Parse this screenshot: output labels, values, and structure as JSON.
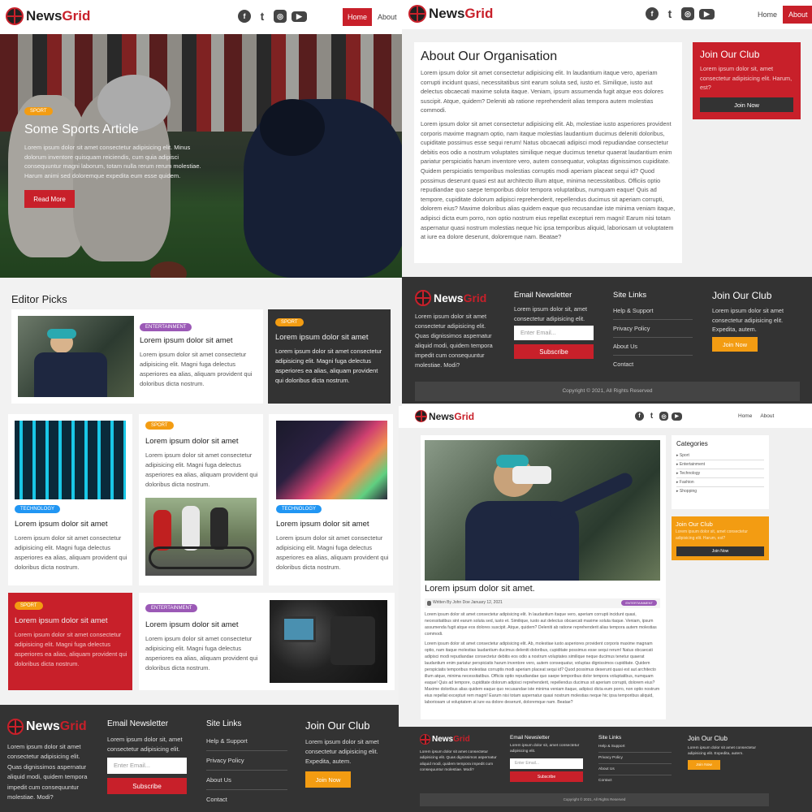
{
  "brand": {
    "news": "News",
    "grid": "Grid"
  },
  "nav": {
    "home": "Home",
    "about": "About"
  },
  "social": {
    "facebook": "f",
    "twitter": "t",
    "instagram": "◎",
    "youtube": "▶"
  },
  "hero": {
    "badge": "Sport",
    "title": "Some Sports Article",
    "text": "Lorem ipsum dolor sit amet consectetur adipisicing elit. Minus dolorum inventore quisquam reiciendis, cum quia adipisci consequuntur magni laborum, totam nulla rerum rerum molestiae. Harum animi sed doloremque expedita eum esse quidem.",
    "button": "Read More"
  },
  "editor": {
    "heading": "Editor Picks",
    "card_title": "Lorem ipsum dolor sit amet",
    "card_text": "Lorem ipsum dolor sit amet consectetur adipisicing elit. Magni fuga delectus asperiores ea alias, aliquam provident qui doloribus dicta nostrum.",
    "badges": {
      "entertainment": "Entertainment",
      "sport": "Sport",
      "technology": "Technology"
    }
  },
  "about": {
    "title": "About Our Organisation",
    "p1": "Lorem ipsum dolor sit amet consectetur adipisicing elit. In laudantium itaque vero, aperiam corrupti incidunt quasi, necessitatibus sint earum soluta sed, iusto et. Similique, iusto aut delectus obcaecati maxime soluta itaque. Veniam, ipsum assumenda fugit atque eos dolores suscipit. Atque, quidem? Deleniti ab ratione reprehenderit alias tempora autem molestias commodi.",
    "p2": "Lorem ipsum dolor sit amet consectetur adipisicing elit. Ab, molestiae iusto asperiores provident corporis maxime magnam optio, nam itaque molestias laudantium ducimus deleniti doloribus, cupiditate possimus esse sequi rerum! Natus obcaecati adipisci modi repudiandae consectetur debitis eos odio a nostrum voluptates similique neque ducimus tenetur quaerat laudantium enim pariatur perspiciatis harum inventore vero, autem consequatur, voluptas dignissimos cupiditate. Quidem perspiciatis temporibus molestias corruptis modi aperiam placeat sequi id? Quod possimus deserunt quasi est aut architecto illum atque, minima necessitatibus. Officiis optio repudiandae quo saepe temporibus dolor tempora voluptatibus, numquam eaque! Quis ad tempore, cupiditate dolorum adipisci reprehenderit, repellendus ducimus sit aperiam corrupti, dolorem eius? Maxime doloribus alias quidem eaque quo recusandae iste minima veniam itaque, adipisci dicta eum porro, non optio nostrum eius repellat excepturi rem magni! Earum nisi totam aspernatur quasi nostrum molestias neque hic ipsa temporibus aliquid, laboriosam ut voluptatem at iure ea dolore deserunt, doloremque nam. Beatae?"
  },
  "club": {
    "title": "Join Our Club",
    "text": "Lorem ipsum dolor sit, amet consectetur adipisicing elit. Harum, est?",
    "button": "Join Now",
    "footer_text": "Lorem ipsum dolor sit amet consectetur adipisicing elit. Expedita, autem."
  },
  "footer": {
    "about_text": "Lorem ipsum dolor sit amet consectetur adipisicing elit. Quas dignissimos aspernatur aliquid modi, quidem tempora impedit cum consequuntur molestiae. Modi?",
    "newsletter_title": "Email Newsletter",
    "newsletter_text": "Lorem ipsum dolor sit, amet consectetur adipisicing elit.",
    "email_placeholder": "Enter Email...",
    "subscribe": "Subscribe",
    "links_title": "Site Links",
    "links": [
      "Help & Support",
      "Privacy Policy",
      "About Us",
      "Contact"
    ],
    "copyright": "Copyright © 2021, All Rights Reserved"
  },
  "article": {
    "title": "Lorem ipsum dolor sit amet.",
    "meta": "Written By John Doe January 12, 2021",
    "badge": "Entertainment",
    "p1": "Lorem ipsum dolor sit amet consectetur adipisicing elit. In laudantium itaque vero, aperiam corrupti incidunt quasi, necessitatibus sint earum soluta sed, iusto et. Similique, iusto aut delectus obcaecati maxime soluta itaque. Veniam, ipsum assumenda fugit atque eos dolores suscipit. Atque, quidem? Deleniti ab ratione reprehenderit alias tempora autem molestias commodi.",
    "p2": "Lorem ipsum dolor sit amet consectetur adipisicing elit. Ab, molestiae iusto asperiores provident corporis maxime magnam optio, nam itaque molestias laudantium ducimus deleniti doloribus, cupiditate possimus esse sequi rerum! Natus obcaecati adipisci modi repudiandae consectetur debitis eos odio a nostrum voluptates similique neque ducimus tenetur quaerat laudantium enim pariatur perspiciatis harum inventore vero, autem consequatur, voluptas dignissimos cupiditate. Quidem perspiciatis temporibus molestias corruptis modi aperiam placeat sequi id? Quod possimus deserunt quasi est aut architecto illum atque, minima necessitatibus. Officiis optio repudiandae quo saepe temporibus dolor tempora voluptatibus, numquam eaque! Quis ad tempore, cupiditate dolorum adipisci reprehenderit, repellendus ducimus sit aperiam corrupti, dolorem eius? Maxime doloribus alias quidem eaque quo recusandae iste minima veniam itaque, adipisci dicta eum porro, non optio nostrum eius repellat excepturi rem magni! Earum nisi totam aspernatur quasi nostrum molestias neque hic ipsa temporibus aliquid, laboriosam ut voluptatem at iure ea dolore deserunt, doloremque nam. Beatae?"
  },
  "categories": {
    "title": "Categories",
    "items": [
      "Sport",
      "Entertainment",
      "Technology",
      "Fashion",
      "Shopping"
    ]
  },
  "colors": {
    "red": "#c8202a",
    "orange": "#f39c12",
    "dark": "#333333",
    "purple": "#9b59b6",
    "blue": "#2196f3"
  }
}
